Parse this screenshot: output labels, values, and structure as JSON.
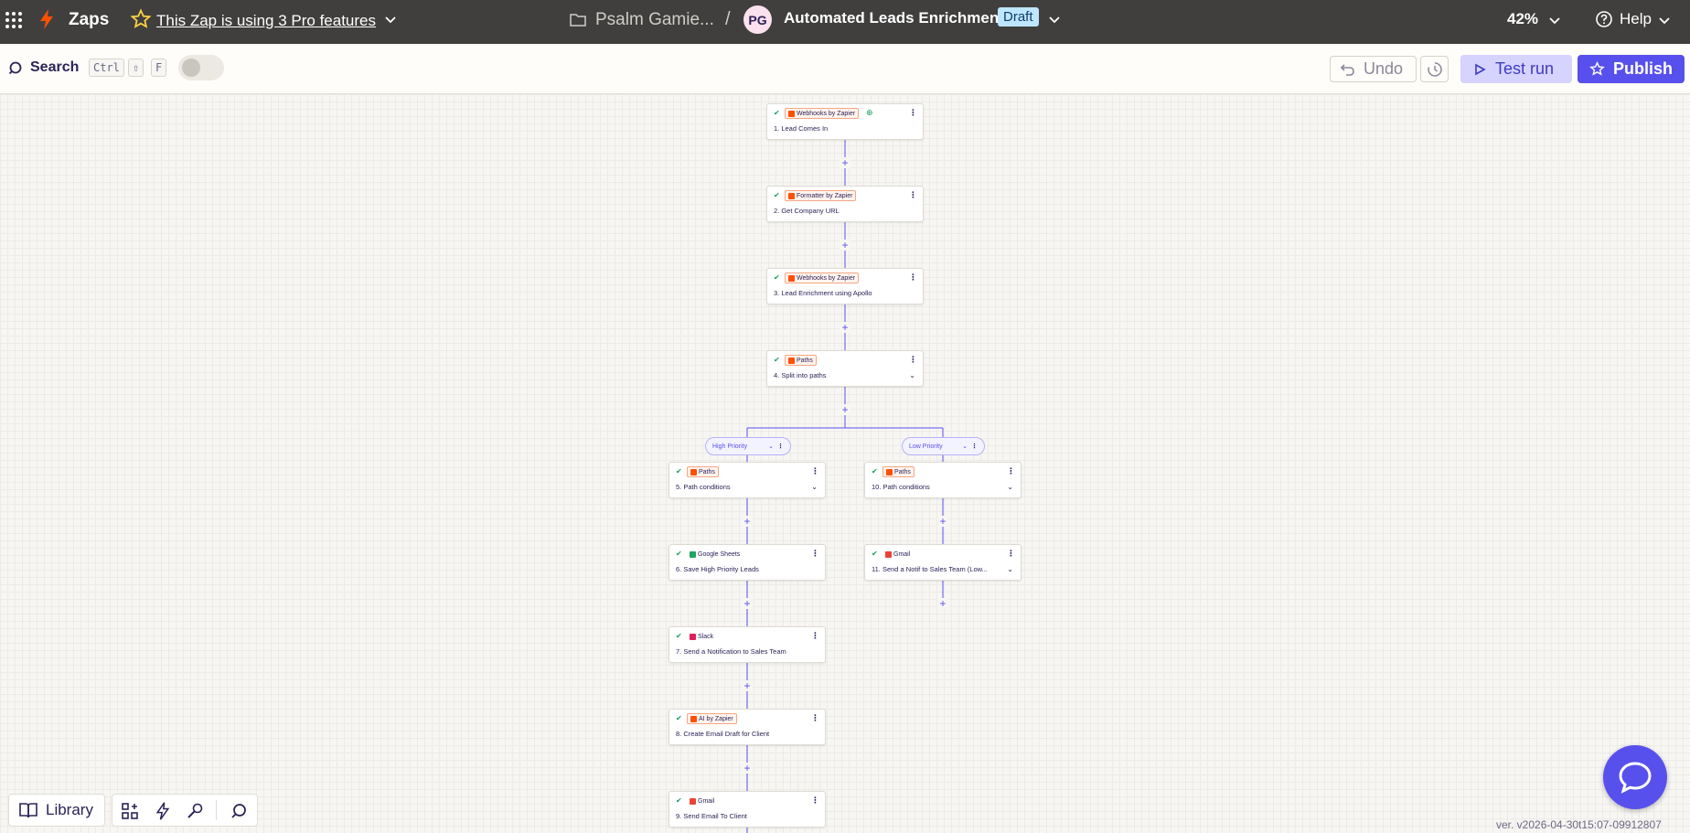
{
  "topbar": {
    "app_title": "Zaps",
    "pro_features": "This Zap is using 3 Pro features",
    "folder": "Psalm Gamie...",
    "separator": "/",
    "avatar_initials": "PG",
    "zap_name": "Automated Leads Enrichment",
    "status_badge": "Draft",
    "zoom": "42%",
    "help": "Help"
  },
  "toolbar": {
    "search_label": "Search",
    "shortcut_keys": [
      "Ctrl",
      "⇧",
      "F"
    ],
    "undo_label": "Undo",
    "test_run_label": "Test run",
    "publish_label": "Publish"
  },
  "colors": {
    "topbar_bg": "#403f3e",
    "accent": "#5850ec",
    "success": "#1b9b5a",
    "zapier_orange": "#ff4f00"
  },
  "steps": [
    {
      "app": "Webhooks by Zapier",
      "title": "1. Lead Comes In",
      "icon": "webhook-icon"
    },
    {
      "app": "Formatter by Zapier",
      "title": "2. Get Company URL",
      "icon": "formatter-icon"
    },
    {
      "app": "Webhooks by Zapier",
      "title": "3. Lead Enrichment using Apollo",
      "icon": "webhook-icon"
    },
    {
      "app": "Paths",
      "title": "4. Split into paths",
      "icon": "paths-icon"
    },
    {
      "app": "Paths",
      "title": "5. Path conditions",
      "icon": "paths-icon"
    },
    {
      "app": "Google Sheets",
      "title": "6. Save High Priority Leads",
      "icon": "sheets-icon"
    },
    {
      "app": "Slack",
      "title": "7. Send a Notification to Sales Team",
      "icon": "slack-icon"
    },
    {
      "app": "AI by Zapier",
      "title": "8. Create Email Draft for Client",
      "icon": "ai-icon"
    },
    {
      "app": "Gmail",
      "title": "9. Send Email To Client",
      "icon": "gmail-icon"
    },
    {
      "app": "Paths",
      "title": "10. Path conditions",
      "icon": "paths-icon"
    },
    {
      "app": "Gmail",
      "title": "11. Send a Notif to Sales Team (Low...",
      "icon": "gmail-icon"
    }
  ],
  "branches": [
    {
      "label": "High Priority"
    },
    {
      "label": "Low Priority"
    }
  ],
  "dock": {
    "library_label": "Library"
  },
  "version": "ver. v2026-04-30t15:07-09912807"
}
